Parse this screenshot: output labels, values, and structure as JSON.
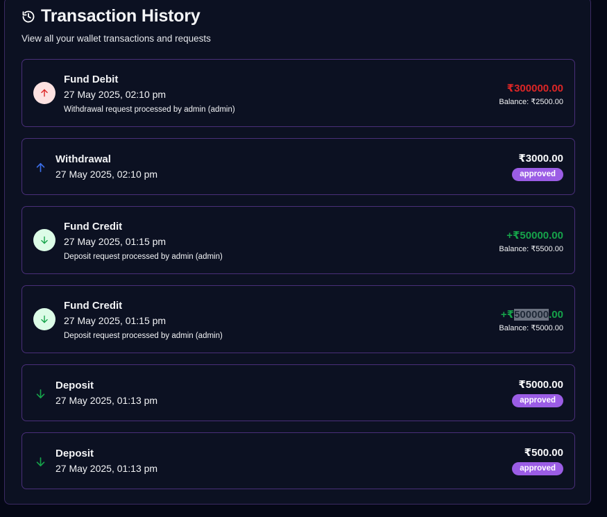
{
  "header": {
    "title": "Transaction History",
    "subtitle": "View all your wallet transactions and requests"
  },
  "transactions": [
    {
      "kind": "debit",
      "title": "Fund Debit",
      "date": "27 May 2025, 02:10 pm",
      "description": "Withdrawal request processed by admin (admin)",
      "amount": "₹300000.00",
      "balance": "Balance: ₹2500.00"
    },
    {
      "kind": "withdrawal",
      "title": "Withdrawal",
      "date": "27 May 2025, 02:10 pm",
      "amount": "₹3000.00",
      "status": "approved"
    },
    {
      "kind": "credit",
      "title": "Fund Credit",
      "date": "27 May 2025, 01:15 pm",
      "description": "Deposit request processed by admin (admin)",
      "amount": "+₹50000.00",
      "balance": "Balance: ₹5500.00"
    },
    {
      "kind": "credit",
      "title": "Fund Credit",
      "date": "27 May 2025, 01:15 pm",
      "description": "Deposit request processed by admin (admin)",
      "amount_prefix": "+₹",
      "amount_highlight": "500000",
      "amount_suffix": ".00",
      "balance": "Balance: ₹5000.00"
    },
    {
      "kind": "deposit",
      "title": "Deposit",
      "date": "27 May 2025, 01:13 pm",
      "amount": "₹5000.00",
      "status": "approved"
    },
    {
      "kind": "deposit",
      "title": "Deposit",
      "date": "27 May 2025, 01:13 pm",
      "amount": "₹500.00",
      "status": "approved"
    }
  ],
  "colors": {
    "debit": "#dc2626",
    "credit": "#16a34a",
    "withdrawal_arrow": "#3b6ee8",
    "badge": "#9b5de5"
  },
  "icons": [
    "history-icon",
    "arrow-up-icon",
    "arrow-down-icon"
  ]
}
